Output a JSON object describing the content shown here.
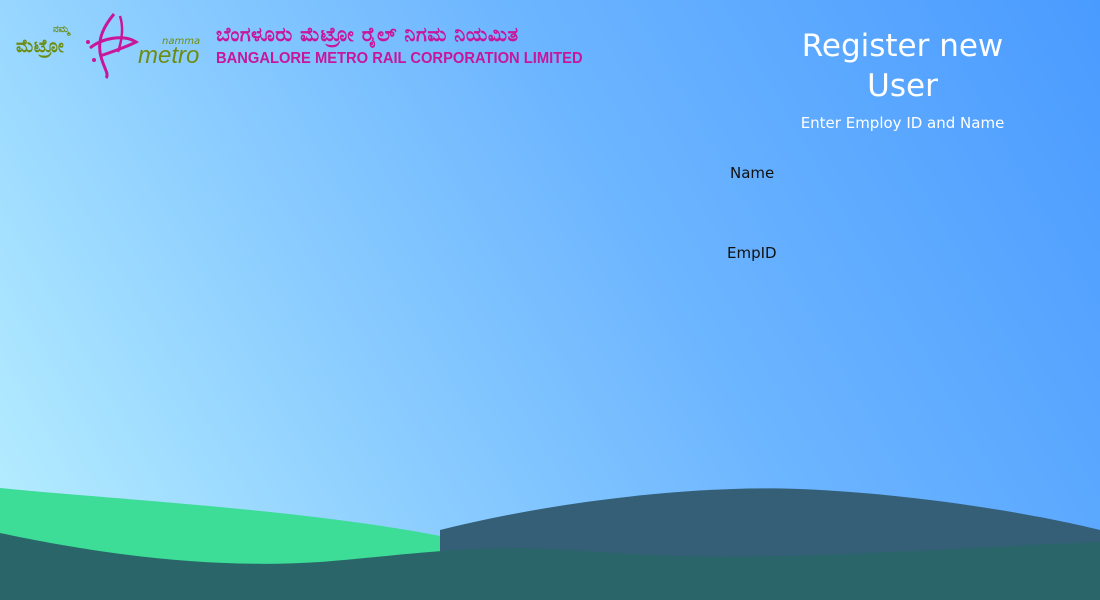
{
  "header": {
    "logo_small_kn": "ನಮ್ಮ",
    "logo_big_kn": "ಮೆಟ್ರೋ",
    "logo_namma": "namma",
    "logo_metro": "metro",
    "org_name_kn": "ಬೆಂಗಳೂರು ಮೆಟ್ರೋ ರೈಲ್ ನಿಗಮ ನಿಯಮಿತ",
    "org_name_en": "BANGALORE METRO RAIL CORPORATION LIMITED"
  },
  "form": {
    "title_line1": "Register new",
    "title_line2": "User",
    "subtitle": "Enter Employ ID and Name",
    "name_label": "Name",
    "name_value": "",
    "empid_label": "EmpID",
    "empid_value": ""
  },
  "colors": {
    "brand_magenta": "#c8169b",
    "brand_green": "#6c8d12",
    "wave_green": "#3ddc97",
    "wave_dark": "#2a6669"
  }
}
